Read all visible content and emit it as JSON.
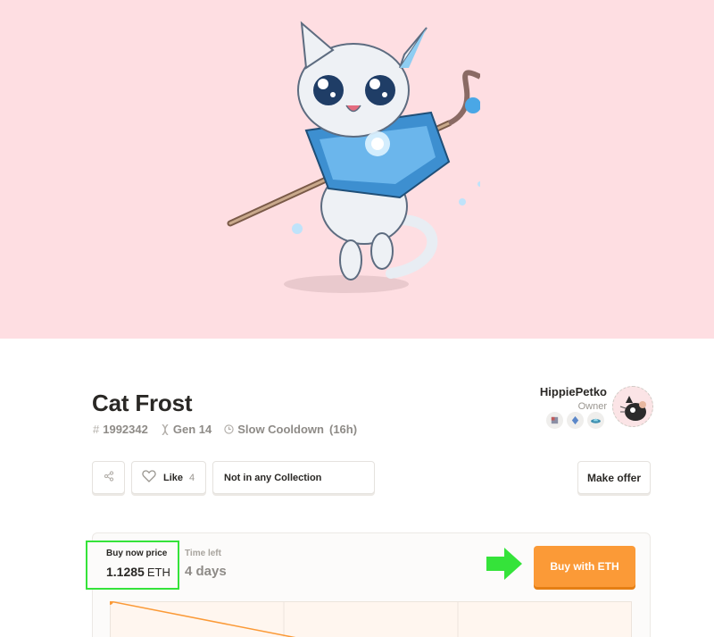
{
  "cat": {
    "name": "Cat Frost",
    "id": "1992342",
    "generation": "Gen 14",
    "cooldown": "Slow Cooldown",
    "cooldown_duration": "(16h)"
  },
  "owner": {
    "name": "HippiePetko",
    "role": "Owner",
    "badges": [
      "cube-badge-icon",
      "crystal-badge-icon",
      "ufo-badge-icon"
    ]
  },
  "actions": {
    "like_label": "Like",
    "like_count": "4",
    "collection_label": "Not in any Collection",
    "offer_label": "Make offer"
  },
  "sale": {
    "price_label": "Buy now price",
    "price_value": "1.1285",
    "price_unit": "ETH",
    "time_label": "Time left",
    "time_value": "4 days",
    "buy_label": "Buy with ETH"
  },
  "colors": {
    "hero_bg": "#fedee2",
    "buy_button": "#fb9a37",
    "highlight": "#35e33a"
  }
}
